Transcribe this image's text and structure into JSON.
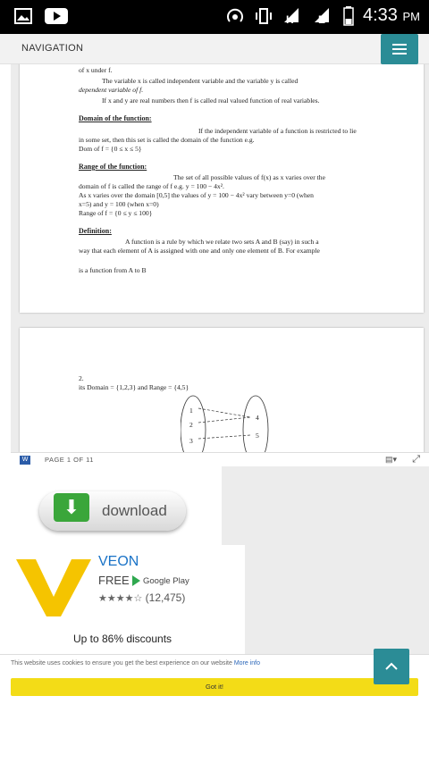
{
  "status_bar": {
    "time": "4:33",
    "ampm": "PM",
    "net_h": "H",
    "net_e": "E"
  },
  "nav": {
    "title": "NAVIGATION"
  },
  "document": {
    "p1_lines": [
      "of x under f.",
      "The variable x is called independent variable and the variable y is called",
      "dependent variable of f.",
      "If x and y are real numbers then f is called real valued function of real variables.",
      "Domain of the function:",
      "If the independent variable of a function is restricted to lie",
      "in some set, then this set is called the domain of the function e.g.",
      "Dom of f = {0 ≤ x ≤ 5}",
      "Range of the function:",
      "The set of all possible values of f(x) as x varies over the",
      "domain of f is called the range of f e.g. y = 100 − 4x².",
      "As x varies over the domain [0,5] the values of  y = 100 − 4x² vary  between y=0 (when",
      "x=5) and y = 100 (when x=0)",
      "Range of f = {0 ≤ y ≤ 100}",
      "Definition:",
      "A function is a rule by which we relate two sets A and B (say) in such a",
      "way that each element of A is assigned with one and only one element of B. For example",
      "is a function from A to B"
    ],
    "p2_lines": [
      "2.",
      "its Domain = {1,2,3} and Range = {4,5}"
    ],
    "diagram_left": [
      "1",
      "2",
      "3"
    ],
    "diagram_right": [
      "4",
      "5"
    ]
  },
  "viewer_toolbar": {
    "page_indicator": "PAGE 1 OF 11",
    "word_icon": "W"
  },
  "ad": {
    "download_label": "download",
    "app_name": "VEON",
    "price": "FREE",
    "store": "Google Play",
    "stars": "★★★★☆",
    "rating_count": "(12,475)",
    "promo": "Up to 86% discounts"
  },
  "cookie": {
    "text": "This website uses cookies to ensure you get the best experience on our website",
    "more_info": "More info",
    "button": "Got it!"
  },
  "colors": {
    "accent": "#2b8c96",
    "cookie_button": "#f3dc17",
    "veon_yellow": "#f5c400"
  },
  "icons": [
    "image-icon",
    "youtube-icon",
    "hotspot-icon",
    "vibrate-icon",
    "signal-icon",
    "battery-icon",
    "menu-icon",
    "word-doc-icon",
    "chevron-up-icon",
    "download-arrow-icon",
    "google-play-icon"
  ]
}
